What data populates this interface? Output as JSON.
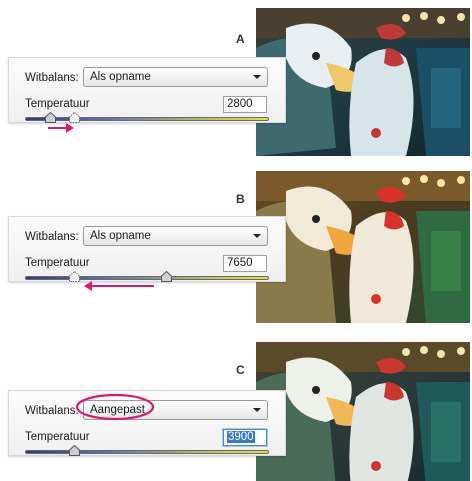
{
  "section_a": {
    "letter": "A",
    "white_balance_label": "Witbalans:",
    "white_balance_value": "Als opname",
    "temperature_label": "Temperatuur",
    "temperature_value": "2800",
    "slider_fraction": 0.1,
    "ghost_fraction": 0.2
  },
  "section_b": {
    "letter": "B",
    "white_balance_label": "Witbalans:",
    "white_balance_value": "Als opname",
    "temperature_label": "Temperatuur",
    "temperature_value": "7650",
    "slider_fraction": 0.58,
    "ghost_fraction": 0.2
  },
  "section_c": {
    "letter": "C",
    "white_balance_label": "Witbalans:",
    "white_balance_value": "Aangepast",
    "temperature_label": "Temperatuur",
    "temperature_value": "3900",
    "slider_fraction": 0.2
  },
  "colors": {
    "annotation": "#d81b72",
    "selection": "#3a78c8"
  }
}
